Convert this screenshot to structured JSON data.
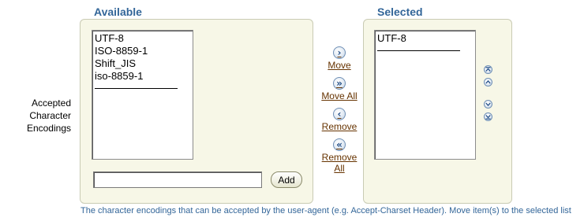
{
  "available": {
    "header": "Available",
    "items": [
      "UTF-8",
      "ISO-8859-1",
      "Shift_JIS",
      "iso-8859-1"
    ],
    "add_label": "Add",
    "add_value": ""
  },
  "selected": {
    "header": "Selected",
    "items": [
      "UTF-8"
    ]
  },
  "field_label": [
    "Accepted",
    "Character",
    "Encodings"
  ],
  "shuttle": {
    "move": "Move",
    "move_all": "Move All",
    "remove": "Remove",
    "remove_all_line1": "Remove",
    "remove_all_line2": "All"
  },
  "icons": {
    "move": "move-right-icon",
    "move_all": "move-all-right-icon",
    "remove": "remove-left-icon",
    "remove_all": "remove-all-left-icon",
    "top": "move-to-top-icon",
    "up": "move-up-icon",
    "down": "move-down-icon",
    "bottom": "move-to-bottom-icon"
  },
  "instructions": "The character encodings that can be accepted by the user-agent (e.g. Accept-Charset Header). Move item(s) to the selected list",
  "colors": {
    "header": "#336699",
    "panel": "#f7f7e7",
    "link": "#663300",
    "instructions": "#336699"
  }
}
